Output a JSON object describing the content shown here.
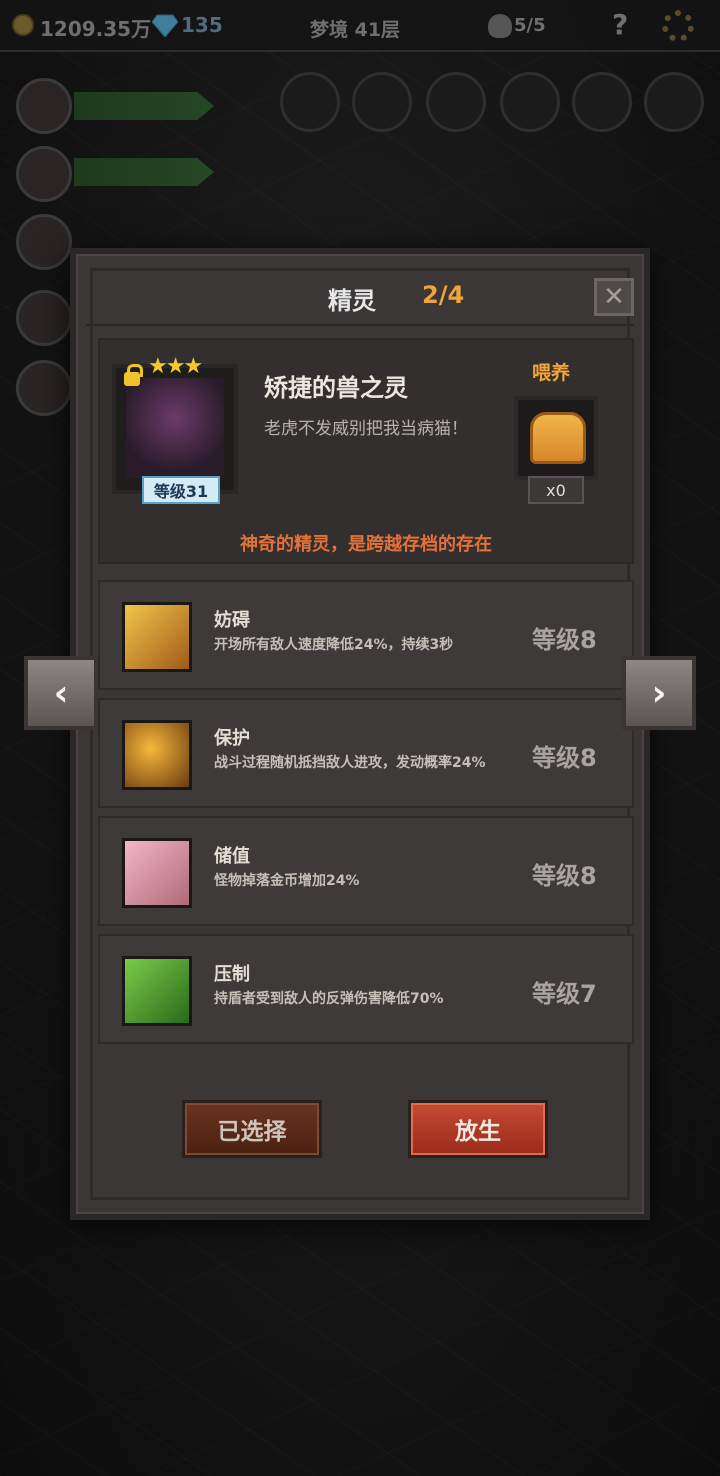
{
  "topbar": {
    "gold": "1209.35万",
    "gems": "135",
    "floor": "梦境 41层",
    "lives": "5/5",
    "help": "?"
  },
  "dialog": {
    "title": "精灵",
    "page": "2/4",
    "close": "✕"
  },
  "spirit": {
    "stars": "★★★",
    "level": "等级31",
    "name": "矫捷的兽之灵",
    "quote": "老虎不发威别把我当病猫！",
    "feed_label": "喂养",
    "feed_count": "x0",
    "description": "神奇的精灵，是跨越存档的存在"
  },
  "skills": [
    {
      "name": "妨碍",
      "desc": "开场所有敌人速度降低24%，持续3秒",
      "level": "等级8",
      "icon": "chain-boot-icon"
    },
    {
      "name": "保护",
      "desc": "战斗过程随机抵挡敌人进攻，发动概率24%",
      "level": "等级8",
      "icon": "shield-dodge-icon"
    },
    {
      "name": "储值",
      "desc": "怪物掉落金币增加24%",
      "level": "等级8",
      "icon": "goblet-icon"
    },
    {
      "name": "压制",
      "desc": "持盾者受到敌人的反弹伤害降低70%",
      "level": "等级7",
      "icon": "beast-claw-icon"
    }
  ],
  "buttons": {
    "selected": "已选择",
    "release": "放生",
    "prev": "‹",
    "next": "›"
  },
  "colors": {
    "accent_orange": "#f0a43a",
    "desc_red": "#e2713a",
    "level_badge": "#d4eaf5",
    "release_button": "#c64b33"
  }
}
